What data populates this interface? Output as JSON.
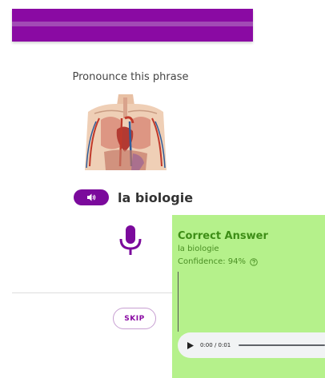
{
  "prompt": "Pronounce this phrase",
  "image": {
    "alt": "anatomy-illustration"
  },
  "phrase": "la biologie",
  "skip_label": "SKIP",
  "feedback": {
    "title": "Correct Answer",
    "phrase": "la biologie",
    "confidence": "Confidence: 94%"
  },
  "audio": {
    "time": "0:00 / 0:01"
  },
  "icons": {
    "speaker": "speaker-icon",
    "mic": "microphone-icon",
    "help": "help-circle-icon",
    "play": "play-icon"
  },
  "colors": {
    "brand": "#8a0aa3",
    "feedback_bg": "#b5f18b",
    "feedback_text": "#3d8d16"
  }
}
